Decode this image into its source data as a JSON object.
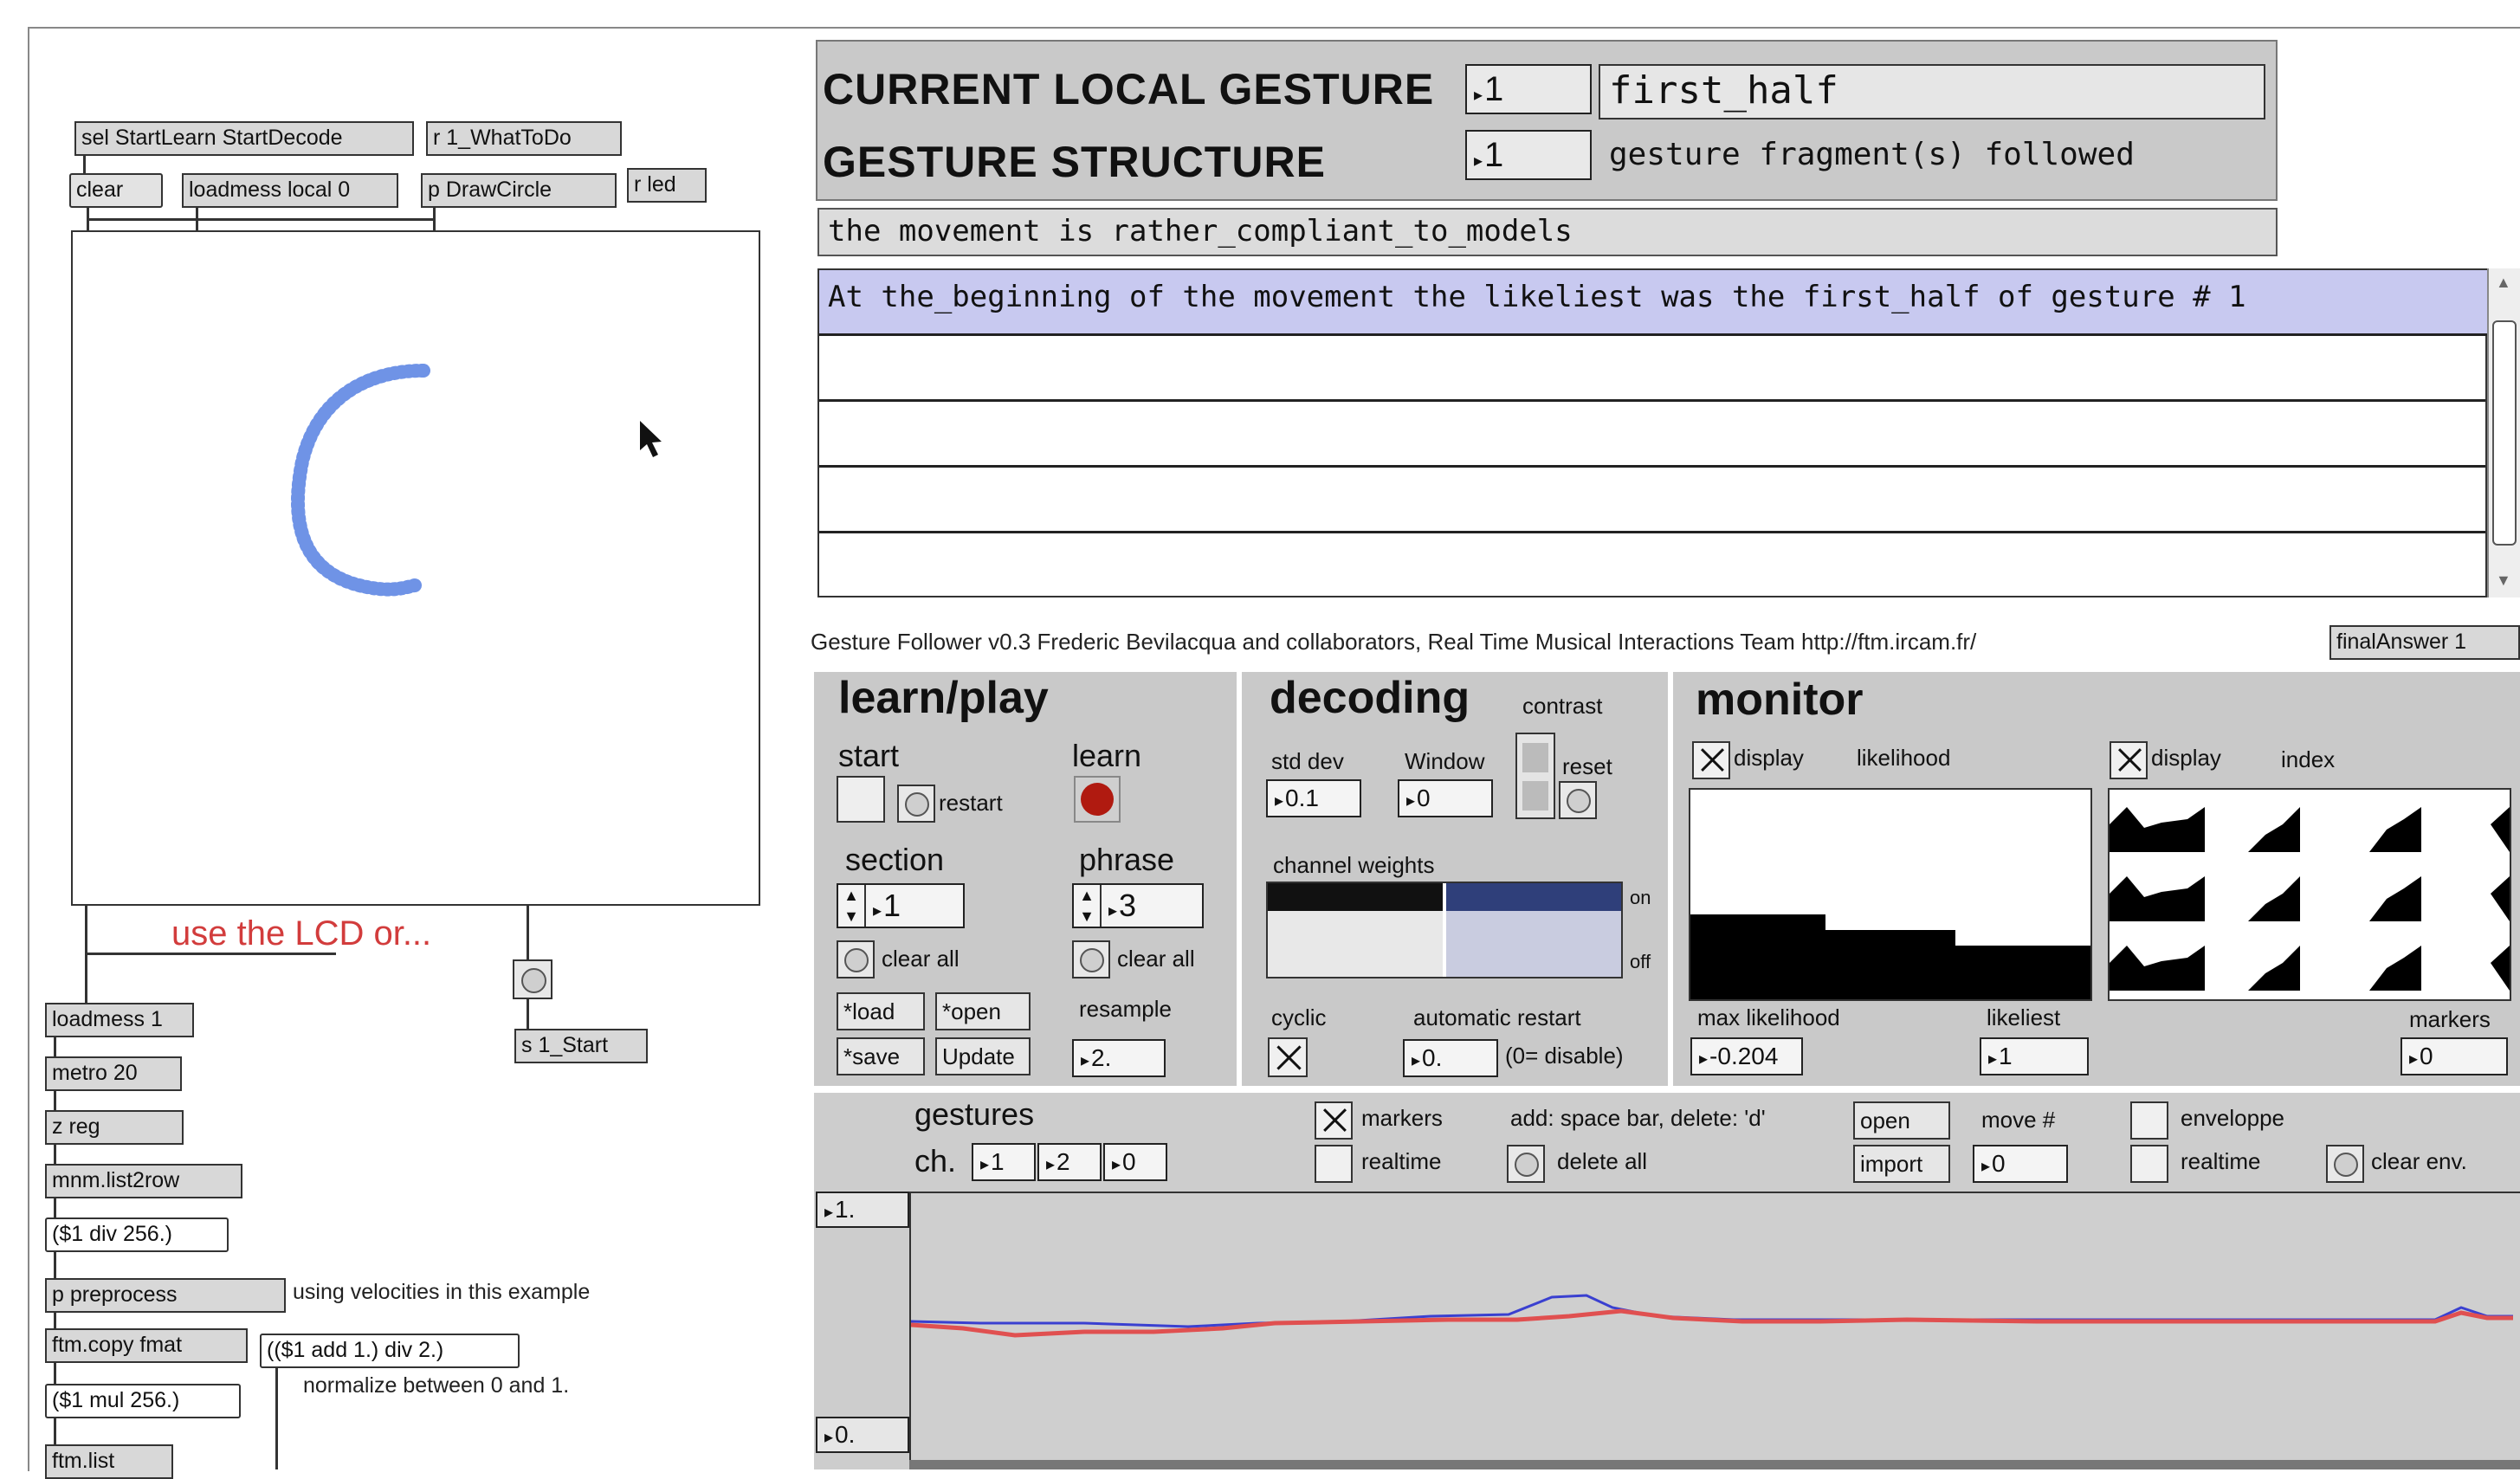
{
  "patch": {
    "sel_object": "sel StartLearn StartDecode",
    "r_whattodo": "r 1_WhatToDo",
    "clear_msg": "clear",
    "loadmess_object": "loadmess local 0",
    "drawcircle_object": "p DrawCircle",
    "r_led": "r led",
    "lcd_hint": "use the LCD or...",
    "s_start": "s 1_Start",
    "loadmess1": "loadmess 1",
    "metro": "metro 20",
    "z_reg": "z reg",
    "list2row": "mnm.list2row",
    "div_expr": "($1 div 256.)",
    "preprocess": "p preprocess",
    "velocities_comment": "using velocities in this example",
    "ftm_copy": "ftm.copy fmat",
    "add_expr": "(($1 add 1.) div 2.)",
    "normalize_comment": "normalize between 0 and 1.",
    "mul_expr": "($1 mul 256.)",
    "ftm_list": "ftm.list"
  },
  "gesture_header": {
    "current_label": "CURRENT LOCAL GESTURE",
    "current_number": "1",
    "current_name": "first_half",
    "structure_label": "GESTURE STRUCTURE",
    "structure_number": "1",
    "structure_text": "gesture fragment(s) followed",
    "compliance_text": "the movement is rather_compliant_to_models"
  },
  "log": {
    "rows": [
      "At the_beginning of the movement the likeliest was the first_half of gesture # 1",
      "",
      "",
      "",
      ""
    ]
  },
  "credits": {
    "text": "Gesture Follower v0.3   Frederic Bevilacqua and collaborators, Real Time Musical Interactions Team  http://ftm.ircam.fr/",
    "final_answer": "finalAnswer 1"
  },
  "learn_play": {
    "title": "learn/play",
    "start_label": "start",
    "restart_label": "restart",
    "learn_label": "learn",
    "section_label": "section",
    "section_value": "1",
    "phrase_label": "phrase",
    "phrase_value": "3",
    "clear_all_label": "clear all",
    "load_label": "*load",
    "open_label": "*open",
    "save_label": "*save",
    "update_label": "Update",
    "resample_label": "resample",
    "resample_value": "2."
  },
  "decoding": {
    "title": "decoding",
    "contrast_label": "contrast",
    "reset_label": "reset",
    "std_dev_label": "std dev",
    "std_dev_value": "0.1",
    "window_label": "Window",
    "window_value": "0",
    "channel_weights_label": "channel weights",
    "on_label": "on",
    "off_label": "off",
    "cyclic_label": "cyclic",
    "auto_restart_label": "automatic restart",
    "auto_restart_value": "0.",
    "disable_hint": "(0= disable)"
  },
  "monitor": {
    "title": "monitor",
    "display_label": "display",
    "likelihood_label": "likelihood",
    "index_label": "index",
    "max_likelihood_label": "max likelihood",
    "max_likelihood_value": "-0.204",
    "likeliest_label": "likeliest",
    "likeliest_value": "1",
    "markers_label": "markers",
    "markers_value": "0"
  },
  "gestures": {
    "title": "gestures",
    "ch_label": "ch.",
    "ch_values": [
      "1",
      "2",
      "0"
    ],
    "markers_label": "markers",
    "realtime_label": "realtime",
    "hint": "add: space bar, delete: 'd'",
    "delete_all_label": "delete all",
    "open_label": "open",
    "import_label": "import",
    "move_label": "move #",
    "move_value": "0",
    "envelope_label": "enveloppe",
    "realtime2_label": "realtime",
    "clear_env_label": "clear env.",
    "y_max": "1.",
    "y_min": "0."
  },
  "colors": {
    "stroke_blue": "#6f93e6",
    "log_highlight": "#c8c9f0",
    "panel_gray": "#c9c9c9",
    "red_led": "#b01a10",
    "hint_red": "#d23c3c",
    "weights_blue": "#2f3f7a",
    "curve_blue": "#3a40d0",
    "curve_red": "#e05050"
  }
}
